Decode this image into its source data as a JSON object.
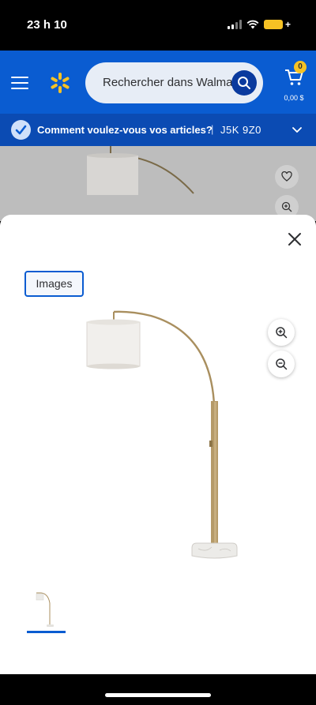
{
  "status_bar": {
    "time": "23 h 10"
  },
  "header": {
    "search_placeholder": "Rechercher dans Walmart",
    "cart_count": "0",
    "cart_total": "0,00 $",
    "brand_color": "#0a5cd1",
    "accent_color": "#f6c224"
  },
  "delivery": {
    "question": "Comment voulez-vous vos articles?",
    "separator": "|",
    "postal_code": "J5K 9Z0"
  },
  "modal": {
    "tab_label": "Images",
    "icons": [
      "close-icon",
      "zoom-in-icon",
      "zoom-out-icon"
    ]
  }
}
